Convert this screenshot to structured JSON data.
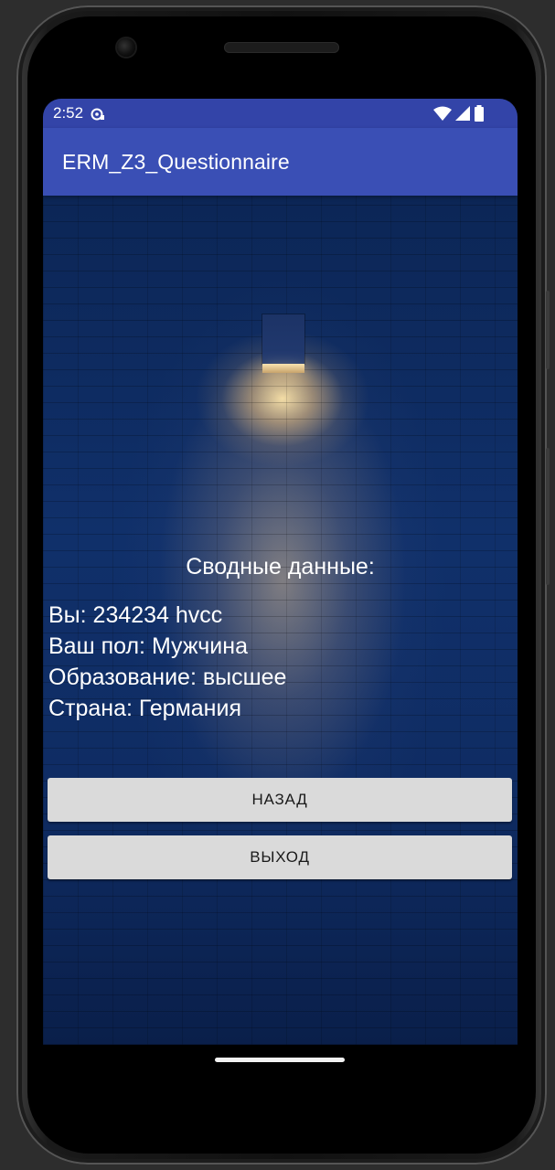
{
  "status_bar": {
    "time": "2:52"
  },
  "app_bar": {
    "title": "ERM_Z3_Questionnaire"
  },
  "summary": {
    "title": "Сводные данные:",
    "lines": [
      "Вы: 234234 hvcc",
      "Ваш пол: Мужчина",
      "Образование: высшее",
      "Страна: Германия"
    ]
  },
  "buttons": {
    "back_label": "НАЗАД",
    "exit_label": "ВЫХОД"
  },
  "colors": {
    "status_bar": "#3344a8",
    "app_bar": "#3a4fb5",
    "button_bg": "#dadada",
    "text_on_dark": "#ffffff"
  },
  "icons": {
    "notification": "notification-icon",
    "wifi": "wifi-icon",
    "signal": "signal-icon",
    "battery": "battery-icon"
  }
}
